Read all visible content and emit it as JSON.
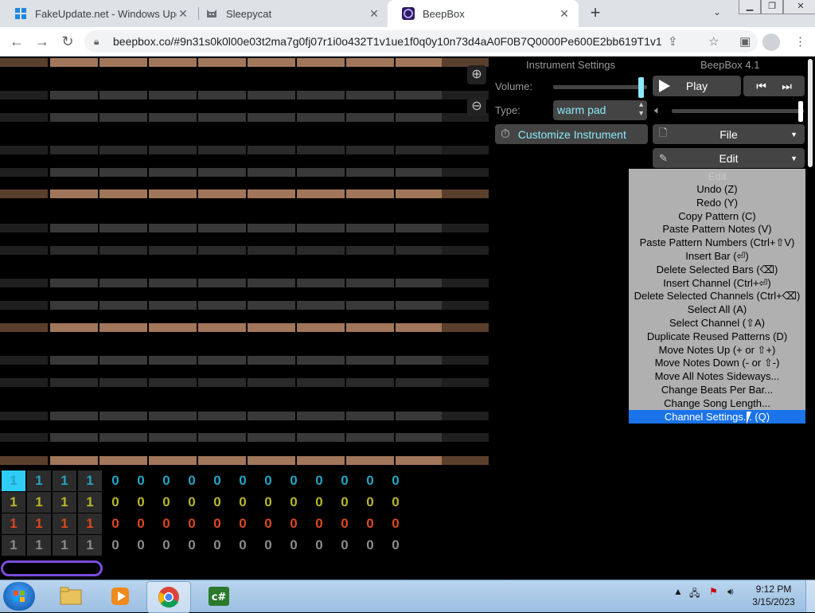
{
  "browser": {
    "tabs": [
      {
        "title": "FakeUpdate.net - Windows Update",
        "icon": "windows-logo-icon"
      },
      {
        "title": "Sleepycat",
        "icon": "cat-icon"
      },
      {
        "title": "BeepBox",
        "icon": "beepbox-icon"
      }
    ],
    "url": "beepbox.co/#9n31s0k0l00e03t2ma7g0fj07r1i0o432T1v1ue1f0q0y10n73d4aA0F0B7Q0000Pe600E2bb619T1v1ub..."
  },
  "panel": {
    "instrument_settings_title": "Instrument Settings",
    "app_version": "BeepBox 4.1",
    "volume_label": "Volume:",
    "volume_level": 0.96,
    "type_label": "Type:",
    "type_value": "warm pad",
    "customize_label": "Customize Instrument",
    "play_label": "Play",
    "file_label": "File",
    "edit_label": "Edit",
    "master_volume_level": 0.98
  },
  "edit_menu": {
    "ghost_label": "Edit",
    "items": [
      "Undo (Z)",
      "Redo (Y)",
      "Copy Pattern (C)",
      "Paste Pattern Notes (V)",
      "Paste Pattern Numbers (Ctrl+⇧V)",
      "Insert Bar (⏎)",
      "Delete Selected Bars (⌫)",
      "Insert Channel (Ctrl+⏎)",
      "Delete Selected Channels (Ctrl+⌫)",
      "Select All (A)",
      "Select Channel (⇧A)",
      "Duplicate Reused Patterns (D)",
      "Move Notes Up (+ or ⇧+)",
      "Move Notes Down (- or ⇧-)",
      "Move All Notes Sideways...",
      "Change Beats Per Bar...",
      "Change Song Length...",
      "Channel Settings... (Q)"
    ],
    "highlighted_index": 17
  },
  "track_editor": {
    "channels": [
      {
        "color": "#25a3c2",
        "values": [
          "1",
          "1",
          "1",
          "1",
          "0",
          "0",
          "0",
          "0",
          "0",
          "0",
          "0",
          "0",
          "0",
          "0",
          "0",
          "0"
        ]
      },
      {
        "color": "#b8b52a",
        "values": [
          "1",
          "1",
          "1",
          "1",
          "0",
          "0",
          "0",
          "0",
          "0",
          "0",
          "0",
          "0",
          "0",
          "0",
          "0",
          "0"
        ]
      },
      {
        "color": "#d9491d",
        "values": [
          "1",
          "1",
          "1",
          "1",
          "0",
          "0",
          "0",
          "0",
          "0",
          "0",
          "0",
          "0",
          "0",
          "0",
          "0",
          "0"
        ]
      },
      {
        "color": "#8a8a8a",
        "values": [
          "1",
          "1",
          "1",
          "1",
          "0",
          "0",
          "0",
          "0",
          "0",
          "0",
          "0",
          "0",
          "0",
          "0",
          "0",
          "0"
        ]
      }
    ],
    "selected_cell": {
      "channel": 0,
      "bar": 0
    }
  },
  "taskbar": {
    "apps": [
      "file-explorer-icon",
      "media-player-icon",
      "chrome-icon",
      "csharp-icon"
    ],
    "time": "9:12 PM",
    "date": "3/15/2023"
  }
}
